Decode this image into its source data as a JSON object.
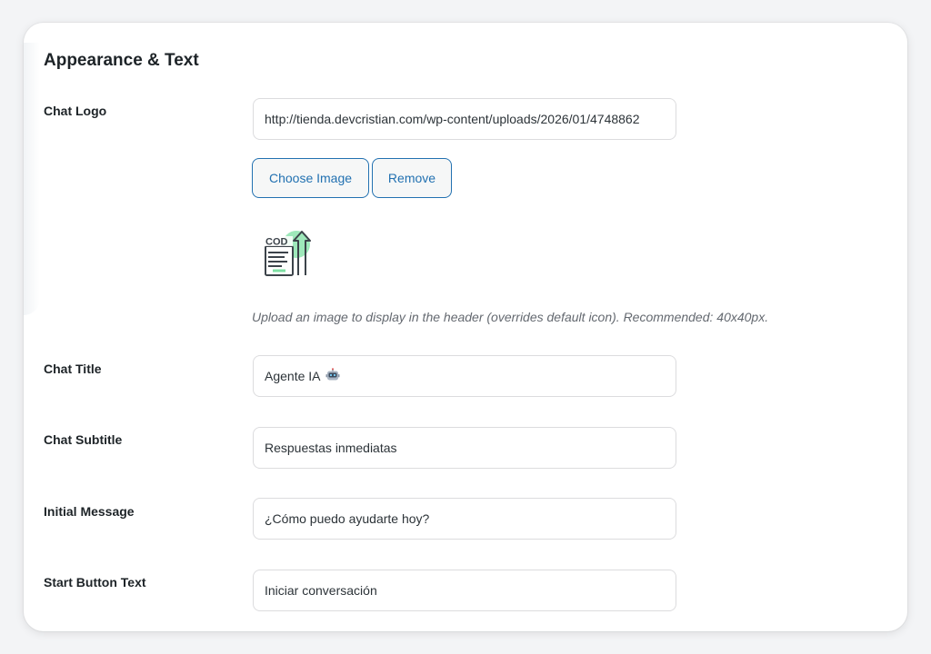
{
  "section": {
    "title": "Appearance & Text"
  },
  "fields": {
    "logo": {
      "label": "Chat Logo",
      "value": "http://tienda.devcristian.com/wp-content/uploads/2026/01/4748862",
      "choose_label": "Choose Image",
      "remove_label": "Remove",
      "logo_text": "COD",
      "help": "Upload an image to display in the header (overrides default icon). Recommended: 40x40px."
    },
    "title": {
      "label": "Chat Title",
      "value": "Agente IA",
      "emoji_icon": "robot-emoji-icon"
    },
    "subtitle": {
      "label": "Chat Subtitle",
      "value": "Respuestas inmediatas"
    },
    "initial_message": {
      "label": "Initial Message",
      "value": "¿Cómo puedo ayudarte hoy?"
    },
    "start_button": {
      "label": "Start Button Text",
      "value": "Iniciar conversación"
    }
  },
  "colors": {
    "accent": "#2271b1",
    "logo_green": "#7ee0a3",
    "logo_stroke": "#3c434a"
  }
}
